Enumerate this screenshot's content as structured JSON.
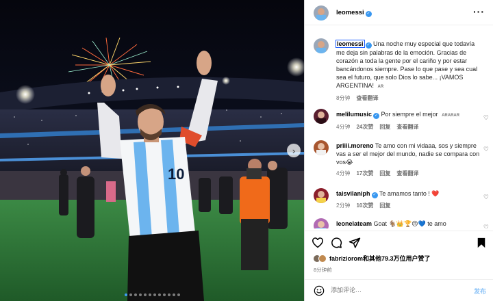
{
  "post": {
    "author": "leomessi",
    "more_icon": "more-horizontal-icon",
    "caption": {
      "username": "leomessi",
      "text": "Una noche muy especial que todavía me deja sin palabras de la emoción. Gracias de corazón a toda la gente por el cariño y por estar bancándonos siempre. Pase lo que pase y sea cual sea el futuro, que solo Dios lo sabe... ¡VAMOS ARGENTINA!",
      "lang_tag": "AR",
      "time": "8分钟",
      "translate": "查看翻译"
    },
    "comments": [
      {
        "username": "melilumusic",
        "verified": true,
        "text": "Por siempre el mejor",
        "lang_tag": "ARARAR",
        "time": "4分钟",
        "likes": "24次赞",
        "reply": "回复",
        "translate": "查看翻译",
        "avatar_color": "#5a1f30"
      },
      {
        "username": "priiii.moreno",
        "verified": false,
        "text": "Te amo con mi vidaaa, sos y siempre vas a ser el mejor del mundo, nadie se compara con vos😭",
        "time": "4分钟",
        "likes": "17次赞",
        "reply": "回复",
        "translate": "查看翻译",
        "avatar_color": "#a8562f"
      },
      {
        "username": "taisvilaniph",
        "verified": true,
        "text": "Te amamos tanto ! ❤️",
        "time": "2分钟",
        "likes": "10次赞",
        "reply": "回复",
        "translate": "",
        "avatar_color": "#8b1e2b"
      },
      {
        "username": "leonelateam",
        "verified": false,
        "text": "Goat 🐐👑🏆😢💙 te amo",
        "time": "",
        "likes": "",
        "reply": "",
        "translate": "",
        "avatar_color": "#b06ab3"
      }
    ],
    "actions": {
      "like_icon": "heart-icon",
      "comment_icon": "comment-icon",
      "share_icon": "share-icon",
      "save_icon": "bookmark-icon"
    },
    "likes_text": "fabriziorom和其他79.3万位用户赞了",
    "likes_user": "fabriziorom",
    "likes_rest": "和其他79.3万位用户赞了",
    "time_ago": "8分钟前",
    "add_comment_placeholder": "添加评论…",
    "post_button": "发布",
    "emoji_icon": "emoji-icon",
    "jersey_number": "10",
    "carousel": {
      "current": 1,
      "total": 12
    }
  },
  "colors": {
    "verified": "#3897f0",
    "link_blue": "#8ec4f7",
    "jersey_blue": "#6cb4ee",
    "pitch_green": "#2e7a3a"
  }
}
